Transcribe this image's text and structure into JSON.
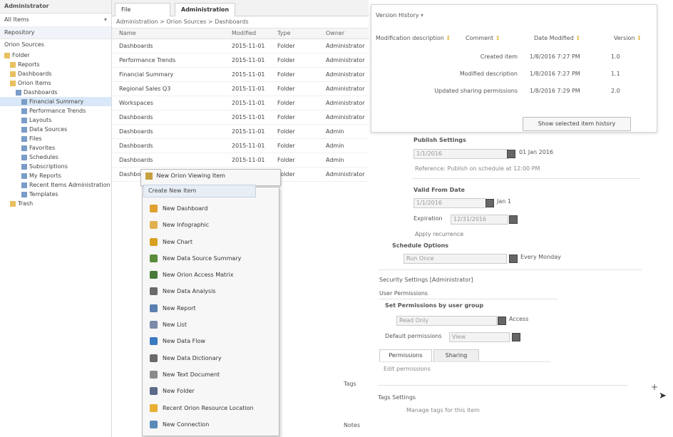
{
  "explorer": {
    "title": "Administrator",
    "filter_label": "All Items",
    "section": "Repository",
    "subsection": "Orion Sources",
    "items": [
      {
        "label": "Folder",
        "level": 0,
        "selected": false
      },
      {
        "label": "Reports",
        "level": 1,
        "selected": false
      },
      {
        "label": "Dashboards",
        "level": 1,
        "selected": false
      },
      {
        "label": "Orion Items",
        "level": 1,
        "selected": false
      },
      {
        "label": "Dashboards",
        "level": 2,
        "selected": false
      },
      {
        "label": "Financial Summary",
        "level": 3,
        "selected": true
      },
      {
        "label": "Performance Trends",
        "level": 3,
        "selected": false
      },
      {
        "label": "Layouts",
        "level": 3,
        "selected": false
      },
      {
        "label": "Data Sources",
        "level": 3,
        "selected": false
      },
      {
        "label": "Files",
        "level": 3,
        "selected": false
      },
      {
        "label": "Favorites",
        "level": 3,
        "selected": false
      },
      {
        "label": "Schedules",
        "level": 3,
        "selected": false
      },
      {
        "label": "Subscriptions",
        "level": 3,
        "selected": false
      },
      {
        "label": "My Reports",
        "level": 3,
        "selected": false
      },
      {
        "label": "Recent Items Administration",
        "level": 3,
        "selected": false
      },
      {
        "label": "Templates",
        "level": 3,
        "selected": false
      },
      {
        "label": "Trash",
        "level": 1,
        "selected": false
      }
    ]
  },
  "list": {
    "tabs": [
      "File",
      "Administration"
    ],
    "breadcrumb": "Administration > Orion Sources > Dashboards",
    "columns": [
      "Name",
      "Modified",
      "Type",
      "Owner"
    ],
    "rows": [
      [
        "Dashboards",
        "2015-11-01",
        "Folder",
        "Administrator"
      ],
      [
        "Performance Trends",
        "2015-11-01",
        "Folder",
        "Administrator"
      ],
      [
        "Financial Summary",
        "2015-11-01",
        "Folder",
        "Administrator"
      ],
      [
        "Regional Sales Q3",
        "2015-11-01",
        "Folder",
        "Administrator"
      ],
      [
        "Workspaces",
        "2015-11-01",
        "Folder",
        "Administrator"
      ],
      [
        "Dashboards",
        "2015-11-01",
        "Folder",
        "Administrator"
      ],
      [
        "Dashboards",
        "2015-11-01",
        "Folder",
        "Admin"
      ],
      [
        "Dashboards",
        "2015-11-01",
        "Folder",
        "Admin"
      ],
      [
        "Dashboards",
        "2015-11-01",
        "Folder",
        "Admin"
      ],
      [
        "Dashboards",
        "2015-11-01",
        "Folder",
        "Administrator"
      ]
    ]
  },
  "context_menu": {
    "top_item": "New Orion Viewing Item",
    "submenu_header": "Create New Item",
    "items": [
      {
        "label": "New Dashboard",
        "color": "#e0a030"
      },
      {
        "label": "New Infographic",
        "color": "#e0b050"
      },
      {
        "label": "New Chart",
        "color": "#d9a020"
      },
      {
        "label": "New Data Source Summary",
        "color": "#5a8c3a"
      },
      {
        "label": "New Orion Access Matrix",
        "color": "#4a7a3a"
      },
      {
        "label": "New Data Analysis",
        "color": "#6a6a6a"
      },
      {
        "label": "New Report",
        "color": "#5a7fb0"
      },
      {
        "label": "New List",
        "color": "#7a8aa8"
      },
      {
        "label": "New Data Flow",
        "color": "#3a7ac0"
      },
      {
        "label": "New Data Dictionary",
        "color": "#6a6a6a"
      },
      {
        "label": "New Text Document",
        "color": "#8a8a8a"
      },
      {
        "label": "New Folder",
        "color": "#5a6a88"
      },
      {
        "label": "Recent Orion Resource Location",
        "color": "#e8b030"
      },
      {
        "label": "New Connection",
        "color": "#5a8ab8"
      }
    ]
  },
  "recent_card": {
    "title": "Version History",
    "columns": [
      "Modification description",
      "Comment",
      "Date Modified",
      "Version"
    ],
    "rows": [
      [
        "Created item",
        "1/8/2016 7:27 PM",
        "1.0"
      ],
      [
        "Modified description",
        "1/8/2016 7:27 PM",
        "1.1"
      ],
      [
        "Updated sharing permissions",
        "1/8/2016 7:29 PM",
        "2.0"
      ]
    ],
    "button_label": "Show selected item history"
  },
  "form": {
    "group1_title": "Publish Settings",
    "date_value": "1/1/2016",
    "date_text": "01 Jan 2016",
    "note": "Reference: Publish on schedule at 12:00 PM",
    "group2_title": "Valid From Date",
    "field2_value": "1/1/2016",
    "field2_text": "Jan 1",
    "field3_label": "Expiration",
    "field3_value": "12/31/2016",
    "field4_label": "Apply recurrence",
    "group3_title": "Schedule Options",
    "field5_value": "Run Once",
    "field5_text": "Every Monday",
    "section_title": "Security Settings [Administrator]",
    "sub_title": "User Permissions",
    "perm_label": "Set Permissions by user group",
    "perm_value": "Read Only",
    "perm_text": "Access",
    "group_label": "Default permissions",
    "group_value": "View",
    "tab_a": "Permissions",
    "tab_b": "Sharing",
    "tab_note": "Edit permissions",
    "bottom_label": "Tags",
    "bottom_section": "Tags Settings",
    "bottom_sub": "Manage tags for this item",
    "bottom_note": "Notes"
  }
}
